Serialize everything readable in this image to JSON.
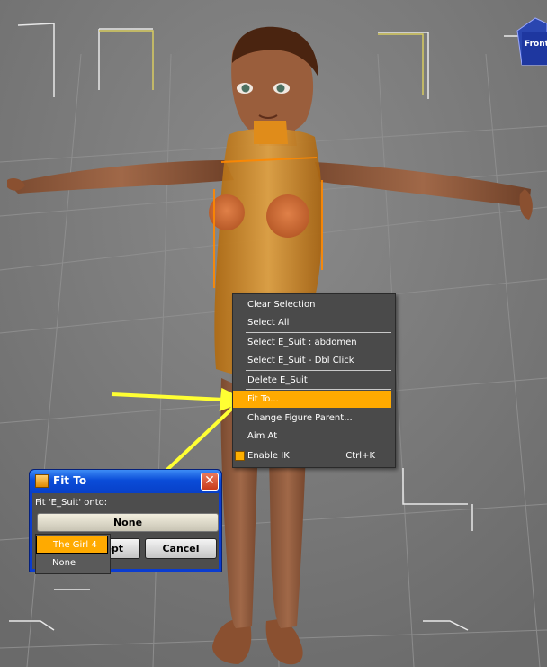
{
  "viewport": {
    "cube_label": "Front",
    "colors": {
      "background": "#7a7a7a",
      "highlight": "#ffaa00",
      "arrow": "#ffff33"
    }
  },
  "context_menu": {
    "items": [
      {
        "label": "Clear Selection"
      },
      {
        "label": "Select All"
      },
      {
        "label": "Select E_Suit : abdomen"
      },
      {
        "label": "Select E_Suit - Dbl Click"
      },
      {
        "label": "Delete E_Suit"
      },
      {
        "label": "Fit To...",
        "highlighted": true
      },
      {
        "label": "Change Figure Parent..."
      },
      {
        "label": "Aim At"
      },
      {
        "label": "Enable IK",
        "shortcut": "Ctrl+K",
        "checked": true
      }
    ]
  },
  "fit_dialog": {
    "title": "Fit To",
    "prompt": "Fit 'E_Suit' onto:",
    "selected_value": "None",
    "accept_label": "Accept",
    "cancel_label": "Cancel"
  },
  "fit_dropdown": {
    "options": [
      {
        "label": "The Girl 4",
        "highlighted": true
      },
      {
        "label": "None"
      }
    ]
  }
}
